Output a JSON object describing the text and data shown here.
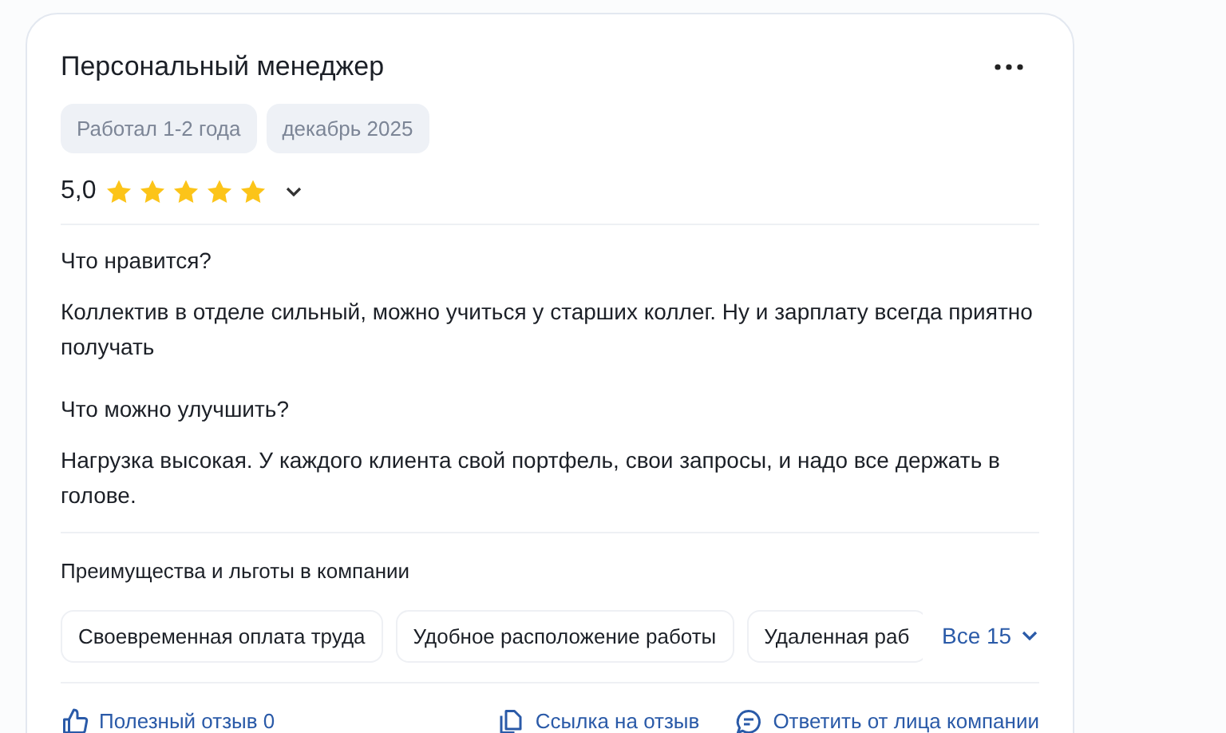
{
  "review": {
    "title": "Персональный менеджер",
    "tags": [
      "Работал 1-2 года",
      "декабрь 2025"
    ],
    "rating": {
      "value": "5,0",
      "stars": 5
    },
    "sections": [
      {
        "heading": "Что нравится?",
        "text": "Коллектив в отделе сильный, можно учиться у старших коллег. Ну и зарплату всегда приятно получать"
      },
      {
        "heading": "Что можно улучшить?",
        "text": "Нагрузка высокая. У каждого клиента свой портфель, свои запросы, и надо все держать в голове."
      }
    ],
    "benefits": {
      "heading": "Преимущества и льготы в компании",
      "items": [
        "Своевременная оплата труда",
        "Удобное расположение работы",
        "Удаленная раб"
      ],
      "more": "Все 15"
    },
    "actions": [
      {
        "kind": "like",
        "label": "Полезный отзыв 0"
      },
      {
        "kind": "link",
        "label": "Ссылка на отзыв"
      },
      {
        "kind": "reply",
        "label": "Ответить от лица компании"
      }
    ]
  }
}
